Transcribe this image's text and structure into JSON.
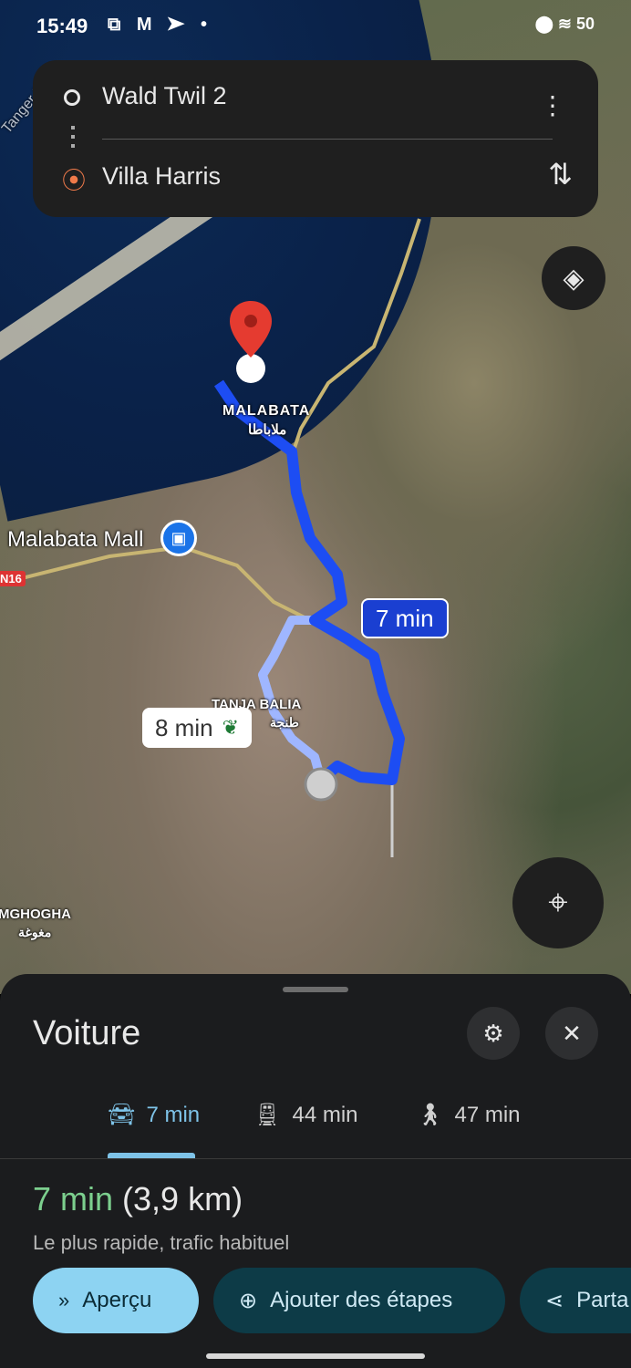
{
  "status_bar": {
    "time": "15:49",
    "notif_icons": "⧉ M ➤ •",
    "right_icons": "⬤ ≋ 50"
  },
  "search": {
    "origin": "Wald Twil 2",
    "destination": "Villa Harris",
    "more_icon": "more-vert-icon",
    "swap_icon": "swap-vertical-icon"
  },
  "map": {
    "labels": {
      "malabata": "MALABATA",
      "malabata_ar": "ملاباطا",
      "mall": "Malabata Mall",
      "tanja_balia": "TANJA BALIA",
      "tanja_balia_ar": "طنجة",
      "mghogha": "MGHOGHA",
      "mghogha_ar": "مغوغة",
      "road": "N16",
      "tanger": "Tanger M"
    },
    "badge_fastest": "7 min",
    "badge_alt": "8 min",
    "colors": {
      "route": "#1d4df3",
      "route_alt": "#9fb6ff"
    }
  },
  "sheet": {
    "title": "Voiture",
    "tabs": [
      {
        "label": "7 min",
        "icon": "car-icon",
        "active": true
      },
      {
        "label": "44 min",
        "icon": "transit-icon",
        "active": false
      },
      {
        "label": "47 min",
        "icon": "walk-icon",
        "active": false
      }
    ],
    "summary_time": "7 min",
    "summary_distance": "(3,9 km)",
    "summary_sub": "Le plus rapide, trafic habituel",
    "chips": {
      "preview": "Aperçu",
      "add_stops": "Ajouter des étapes",
      "share": "Parta"
    },
    "colors": {
      "active_tab": "#7ec3e8",
      "summary": "#7ccf8e",
      "primary_chip": "#8dd3f2",
      "secondary_chip": "#0d3b47"
    }
  }
}
